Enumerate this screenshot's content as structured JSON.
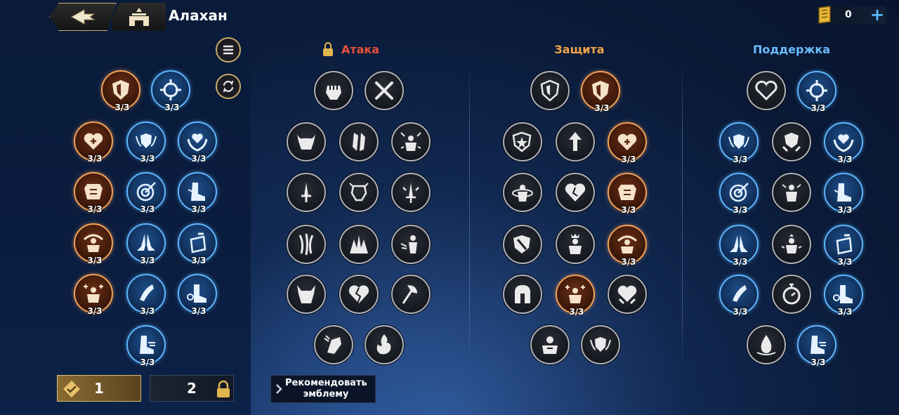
{
  "header": {
    "hero_name": "Алахан",
    "currency_value": "0",
    "currency_plus": "+"
  },
  "columns": {
    "attack": {
      "title": "Атака",
      "color": "#e8503a",
      "locked": true
    },
    "defense": {
      "title": "Защита",
      "color": "#f0a24a"
    },
    "support": {
      "title": "Поддержка",
      "color": "#6cbcff"
    }
  },
  "levels": {
    "full": "3/3"
  },
  "bottom": {
    "tab1_label": "1",
    "tab2_label": "2",
    "recommend_line1": "Рекомендовать",
    "recommend_line2": "эмблему"
  },
  "icons": [
    "back-arrow-icon",
    "hero-castle-icon",
    "list-icon",
    "refresh-icon",
    "gold-icon",
    "lock-icon",
    "emblem-icon"
  ]
}
